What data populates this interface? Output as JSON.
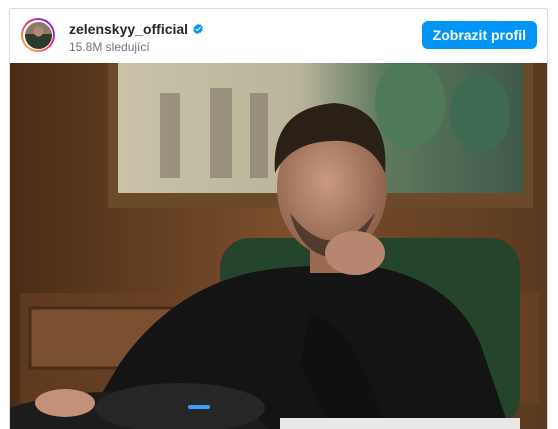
{
  "post": {
    "username": "zelenskyy_official",
    "followers_text": "15.8M sledující",
    "profile_button_label": "Zobrazit profil",
    "verified": true
  },
  "colors": {
    "accent_blue": "#0095f6",
    "verified_blue": "#0095f6"
  },
  "icons": {
    "verified": "verified-badge-icon"
  }
}
